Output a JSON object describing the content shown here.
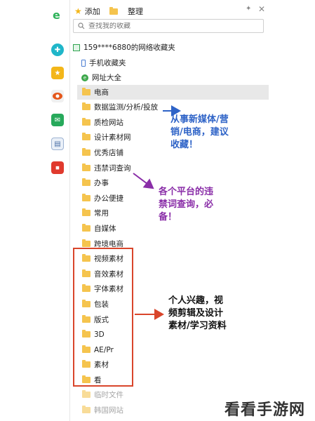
{
  "toolbar": {
    "add_label": "添加",
    "organize_label": "整理"
  },
  "search": {
    "placeholder": "查找我的收藏"
  },
  "account": {
    "label": "159****6880的网络收藏夹"
  },
  "special_items": [
    {
      "label": "手机收藏夹"
    },
    {
      "label": "网址大全"
    }
  ],
  "folders": [
    {
      "label": "电商"
    },
    {
      "label": "数据监测/分析/投放"
    },
    {
      "label": "质检网站"
    },
    {
      "label": "设计素材网"
    },
    {
      "label": "优秀店铺"
    },
    {
      "label": "违禁词查询"
    },
    {
      "label": "办事"
    },
    {
      "label": "办公便捷"
    },
    {
      "label": "常用"
    },
    {
      "label": "自媒体"
    },
    {
      "label": "跨境电商"
    },
    {
      "label": "视频素材"
    },
    {
      "label": "音效素材"
    },
    {
      "label": "字体素材"
    },
    {
      "label": "包装"
    },
    {
      "label": "版式"
    },
    {
      "label": "3D"
    },
    {
      "label": "AE/Pr"
    },
    {
      "label": "素材"
    },
    {
      "label": "看"
    },
    {
      "label": "临时文件"
    },
    {
      "label": "韩国网站"
    }
  ],
  "annotations": {
    "blue_line1": "从事新媒体/营",
    "blue_line2": "销/电商，建议",
    "blue_line3": "收藏！",
    "purple_line1": "各个平台的违",
    "purple_line2": "禁词查询，必",
    "purple_line3": "备！",
    "dark_line1": "个人兴趣，视",
    "dark_line2": "频剪辑及设计",
    "dark_line3": "素材/学习资料"
  },
  "rail_icons": [
    "ie-logo-icon",
    "plus-icon",
    "star-icon",
    "eye-icon",
    "mail-icon",
    "note-icon",
    "red-badge-icon"
  ],
  "colors": {
    "folder": "#f5c44e",
    "annotation_blue": "#2e63c7",
    "annotation_purple": "#8a2ea8",
    "box_red": "#d9452b"
  },
  "watermark": {
    "text": "看看手游网"
  }
}
